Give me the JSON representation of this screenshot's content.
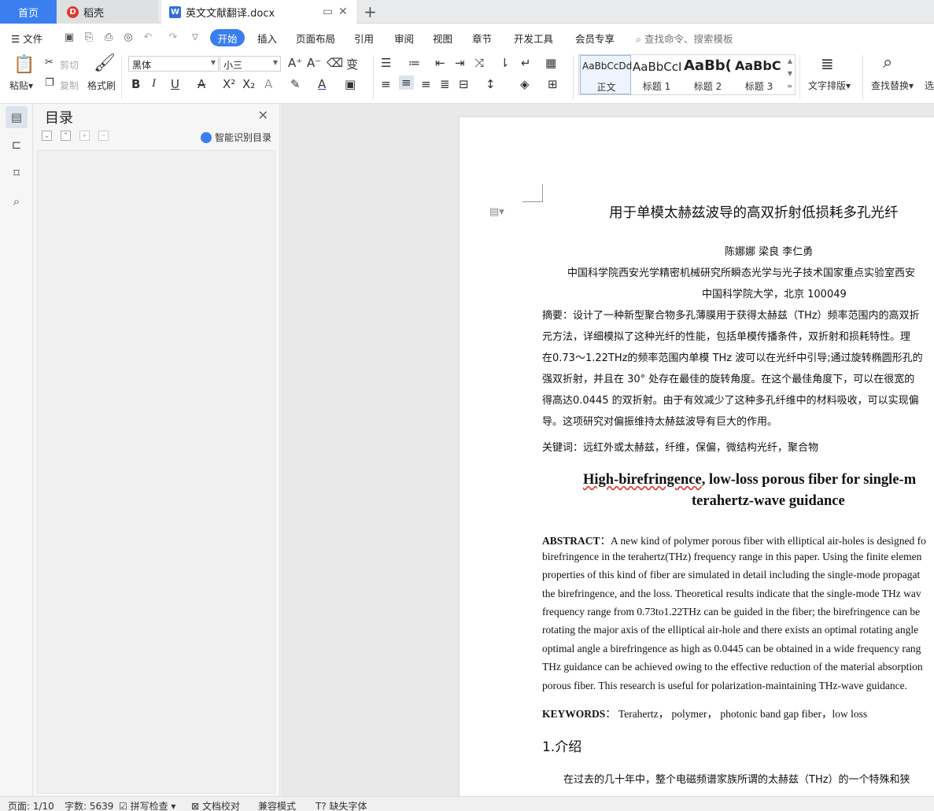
{
  "tabs": {
    "home": "首页",
    "daoke": "稻壳",
    "document": "英文文献翻译.docx"
  },
  "menu": {
    "file": "文件",
    "items": [
      "开始",
      "插入",
      "页面布局",
      "引用",
      "审阅",
      "视图",
      "章节",
      "开发工具",
      "会员专享"
    ],
    "search_placeholder": "查找命令、搜索模板"
  },
  "ribbon": {
    "paste": "粘贴",
    "cut": "剪切",
    "copy": "复制",
    "format_painter": "格式刷",
    "font_name": "黑体",
    "font_size": "小三",
    "styles": [
      {
        "preview": "AaBbCcDd",
        "caption": "正文"
      },
      {
        "preview": "AaBbCcI",
        "caption": "标题 1"
      },
      {
        "preview": "AaBb(",
        "caption": "标题 2"
      },
      {
        "preview": "AaBbC",
        "caption": "标题 3"
      }
    ],
    "text_layout": "文字排版",
    "find_replace": "查找替换",
    "select": "选"
  },
  "toc": {
    "title": "目录",
    "smart": "智能识别目录"
  },
  "document": {
    "title_cn": "用于单模太赫兹波导的高双折射低损耗多孔光纤",
    "authors": "陈娜娜  梁良  李仁勇",
    "affil1": "中国科学院西安光学精密机械研究所瞬态光学与光子技术国家重点实验室西安",
    "affil2": "中国科学院大学，北京 100049",
    "abs_cn": [
      "摘要：设计了一种新型聚合物多孔薄膜用于获得太赫兹（THz）频率范围内的高双折",
      "元方法，详细模拟了这种光纤的性能，包括单模传播条件，双折射和损耗特性。理",
      "在0.73～1.22THz的频率范围内单模 THz 波可以在光纤中引导;通过旋转椭圆形孔的",
      "强双折射，并且在 30° 处存在最佳的旋转角度。在这个最佳角度下，可以在很宽的",
      "得高达0.0445 的双折射。由于有效减少了这种多孔纤维中的材料吸收，可以实现偏",
      "导。这项研究对偏振维持太赫兹波导有巨大的作用。"
    ],
    "keywords_cn": "关键词：远红外或太赫兹，纤维，保偏，微结构光纤，聚合物",
    "title_en_1a": "High-birefringence",
    "title_en_1b": ", low-loss porous fiber for single-m",
    "title_en_2": "terahertz-wave guidance",
    "abs_en_label": "ABSTRACT",
    "abs_en": [
      "：A new kind of polymer porous fiber with elliptical air-holes is designed fo",
      "birefringence in the terahertz(THz) frequency range in this paper. Using the finite elemen",
      "properties of this kind of fiber are simulated in detail including the single-mode propagat",
      "the birefringence, and the loss. Theoretical results indicate that the single-mode THz wav",
      "frequency range from 0.73to1.22THz can be guided in the fiber; the birefringence can be",
      "rotating the major axis of the elliptical air-hole and there exists an optimal rotating angle",
      "optimal angle a birefringence as high as 0.0445 can be obtained in a wide frequency rang",
      "THz guidance can be achieved owing to the effective reduction of the material absorption",
      "porous fiber. This research is useful for polarization-maintaining THz-wave guidance."
    ],
    "keywords_en_label": "KEYWORDS",
    "keywords_en": "：  Terahertz，  polymer，  photonic band gap fiber，low loss",
    "section_1": "1.介绍",
    "intro": "在过去的几十年中，整个电磁频谱家族所谓的太赫兹（THz）的一个特殊和狭"
  },
  "status": {
    "page": "页面: 1/10",
    "words": "字数: 5639",
    "spell": "拼写检查",
    "proof": "文档校对",
    "compat": "兼容模式",
    "missing_font": "缺失字体"
  }
}
